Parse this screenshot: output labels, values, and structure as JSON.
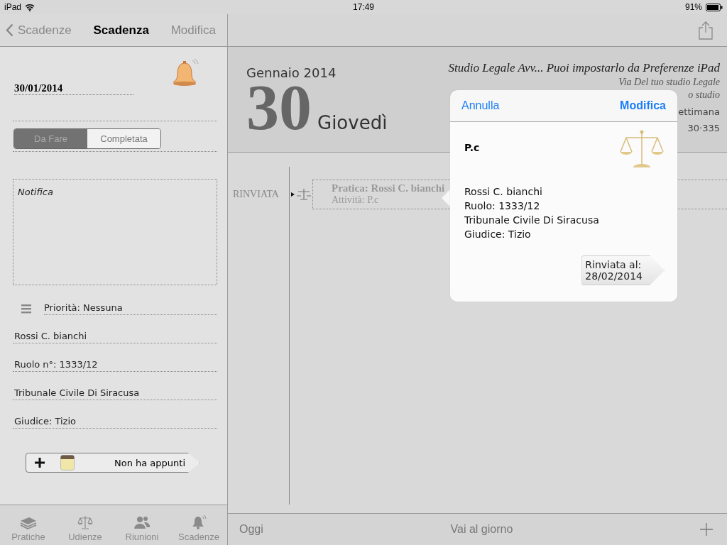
{
  "status_bar": {
    "device": "iPad",
    "time": "17:49",
    "battery": "91%"
  },
  "left_nav": {
    "back": "Scadenze",
    "title": "Scadenza",
    "action": "Modifica"
  },
  "detail": {
    "date": "30/01/2014",
    "status_options": [
      {
        "label": "Da Fare",
        "selected": true
      },
      {
        "label": "Completata",
        "selected": false
      }
    ],
    "notes_placeholder": "Notifica",
    "priority": "Priorità: Nessuna",
    "fields": [
      "Rossi C. bianchi",
      "Ruolo n°: 1333/12",
      "Tribunale Civile Di Siracusa",
      "Giudice: Tizio"
    ],
    "notes_button": "Non ha appunti"
  },
  "tab_bar": [
    {
      "label": "Pratiche",
      "kind": "folders",
      "selected": false
    },
    {
      "label": "Udienze",
      "kind": "scales",
      "selected": false
    },
    {
      "label": "Riunioni",
      "kind": "people",
      "selected": false
    },
    {
      "label": "Scadenze",
      "kind": "bell",
      "selected": false
    }
  ],
  "day_header": {
    "month": "Gennaio 2014",
    "day": "30",
    "weekday": "Giovedì",
    "studio_name": "Studio Legale Avv... Puoi impostarlo da Preferenze iPad",
    "address_lines": [
      "Via Del tuo studio Legale",
      "o studio"
    ],
    "week": "ettimana",
    "day_of_year": "30·335"
  },
  "events": [
    {
      "status": "RINVIATA",
      "title": "Pratica: Rossi C. bianchi",
      "activity": "Attività: P.c"
    }
  ],
  "popover": {
    "cancel": "Annulla",
    "edit": "Modifica",
    "title": "P.c",
    "lines": [
      "Rossi C. bianchi",
      "Ruolo: 1333/12",
      "Tribunale Civile Di Siracusa",
      "Giudice: Tizio"
    ],
    "postponed": [
      "Rinviata al:",
      "28/02/2014"
    ]
  },
  "bottom_toolbar": {
    "today": "Oggi",
    "go_to_day": "Vai al giorno"
  }
}
